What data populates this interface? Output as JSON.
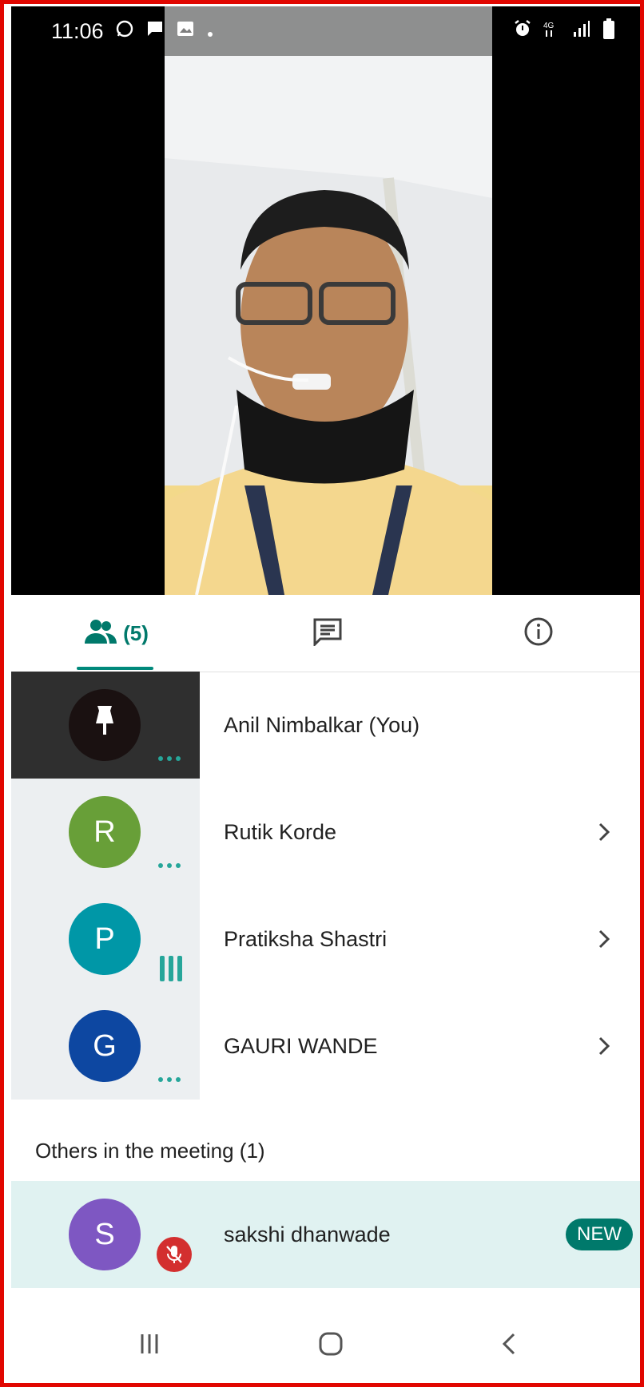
{
  "status_bar": {
    "time": "11:06"
  },
  "tabs": {
    "people_count": "(5)"
  },
  "participants": [
    {
      "name": "Anil Nimbalkar (You)",
      "initial": "",
      "color": "#1a1111"
    },
    {
      "name": "Rutik Korde",
      "initial": "R",
      "color": "#689f38"
    },
    {
      "name": "Pratiksha Shastri",
      "initial": "P",
      "color": "#0097a7"
    },
    {
      "name": "GAURI WANDE",
      "initial": "G",
      "color": "#0d47a1"
    }
  ],
  "others": {
    "heading": "Others in the meeting (1)",
    "name": "sakshi dhanwade",
    "initial": "S",
    "color": "#7e57c2",
    "badge": "NEW"
  },
  "icons": [
    "whatsapp-icon",
    "message-icon",
    "gallery-icon",
    "alarm-icon",
    "network-4g-icon",
    "signal-icon",
    "battery-icon",
    "people-icon",
    "chat-icon",
    "info-icon",
    "pin-icon",
    "chevron-right-icon",
    "mic-off-icon",
    "recents-icon",
    "home-icon",
    "back-icon"
  ]
}
